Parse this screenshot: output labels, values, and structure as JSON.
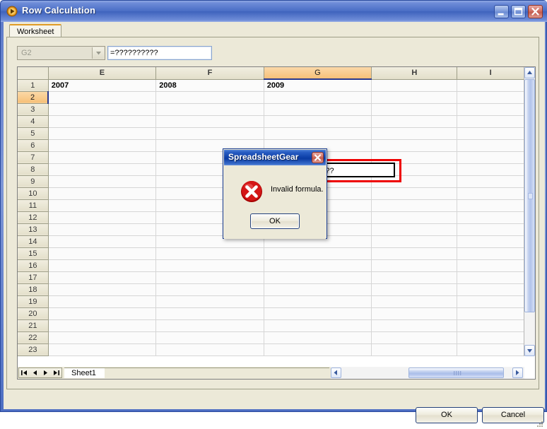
{
  "window": {
    "title": "Row Calculation",
    "icon": "play-circle-icon",
    "caption_buttons": {
      "minimize": "minimize-icon",
      "maximize": "maximize-icon",
      "close": "close-icon"
    }
  },
  "tabs": [
    {
      "label": "Worksheet",
      "selected": true
    }
  ],
  "toolbar": {
    "name_box": {
      "value": "G2",
      "placeholder": "G2"
    },
    "formula_bar": {
      "value": "=??????????",
      "placeholder": ""
    }
  },
  "spreadsheet": {
    "columns": [
      "E",
      "F",
      "G",
      "H",
      "I"
    ],
    "selected_column": "G",
    "selected_row": 2,
    "rows": [
      1,
      2,
      3,
      4,
      5,
      6,
      7,
      8,
      9,
      10,
      11,
      12,
      13,
      14,
      15,
      16,
      17,
      18,
      19,
      20,
      21,
      22,
      23
    ],
    "cells": {
      "E1": "2007",
      "F1": "2008",
      "G1": "2009"
    },
    "active_cell": {
      "ref": "G2",
      "value": "=??????????"
    },
    "sheet_tabs": [
      "Sheet1"
    ],
    "tab_nav": [
      "first-icon",
      "prev-icon",
      "next-icon",
      "last-icon"
    ]
  },
  "annotation": {
    "highlight_color": "#ee0000",
    "arrow_color": "#ee0000"
  },
  "message_box": {
    "title": "SpreadsheetGear",
    "text": "Invalid formula.",
    "icon": "error-icon",
    "ok_label": "OK",
    "close_label": "close-icon"
  },
  "footer": {
    "ok_label": "OK",
    "cancel_label": "Cancel"
  }
}
